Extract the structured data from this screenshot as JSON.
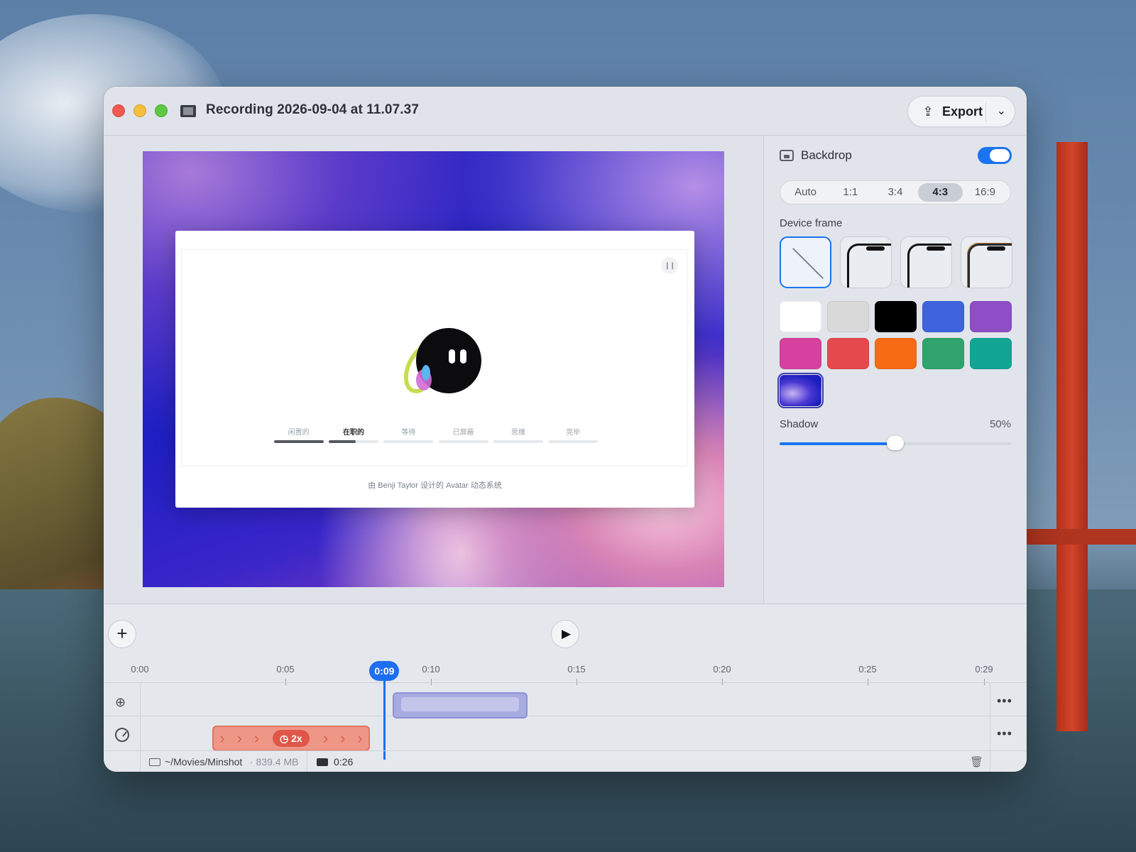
{
  "window": {
    "title": "Recording 2026-09-04 at 11.07.37",
    "export_label": "Export"
  },
  "preview": {
    "tabs": [
      {
        "label": "闲置的",
        "progress": 1.0,
        "active": false
      },
      {
        "label": "在职的",
        "progress": 0.55,
        "active": true
      },
      {
        "label": "等待",
        "progress": 0,
        "active": false
      },
      {
        "label": "已屏蔽",
        "progress": 0,
        "active": false
      },
      {
        "label": "思维",
        "progress": 0,
        "active": false
      },
      {
        "label": "完毕",
        "progress": 0,
        "active": false
      }
    ],
    "credit": "由 Benji Taylor 设计的 Avatar 动态系统"
  },
  "panel": {
    "backdrop_label": "Backdrop",
    "backdrop_enabled": true,
    "aspect_options": [
      "Auto",
      "1:1",
      "3:4",
      "4:3",
      "16:9"
    ],
    "aspect_selected": "4:3",
    "device_frame_label": "Device frame",
    "swatches": [
      "#ffffff",
      "#d9d9d9",
      "#000000",
      "#3e63dd",
      "#8e4ec6",
      "#d6409f",
      "#e5484d",
      "#f76b15",
      "#30a46c",
      "#12a594",
      "gradient"
    ],
    "shadow_label": "Shadow",
    "shadow_value": "50%",
    "shadow_fraction": 0.5
  },
  "timeline": {
    "ticks": [
      "0:00",
      "0:05",
      "0:10",
      "0:15",
      "0:20",
      "0:25",
      "0:29"
    ],
    "playhead": "0:09",
    "speed_label": "2x",
    "path": "~/Movies/Minshot",
    "size": "· 839.4 MB",
    "duration": "0:26"
  }
}
